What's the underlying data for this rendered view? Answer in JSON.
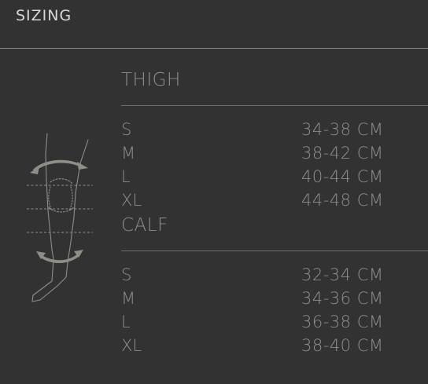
{
  "header": {
    "title": "SIZING"
  },
  "thigh": {
    "title": "THIGH",
    "sizes": [
      {
        "size": "S",
        "range": "34-38 CM"
      },
      {
        "size": "M",
        "range": "38-42 CM"
      },
      {
        "size": "L",
        "range": "40-44 CM"
      },
      {
        "size": "XL",
        "range": "44-48 CM"
      }
    ]
  },
  "calf": {
    "title": "CALF",
    "sizes": [
      {
        "size": "S",
        "range": "32-34 CM"
      },
      {
        "size": "M",
        "range": "34-36 CM"
      },
      {
        "size": "L",
        "range": "36-38 CM"
      },
      {
        "size": "XL",
        "range": "38-40 CM"
      }
    ]
  },
  "colors": {
    "background": "#323232",
    "text": "#8e8e89",
    "header_text": "#d8d8d6",
    "rule": "#6f6f6b"
  },
  "diagram": {
    "icon": "knee-measurement-diagram"
  }
}
